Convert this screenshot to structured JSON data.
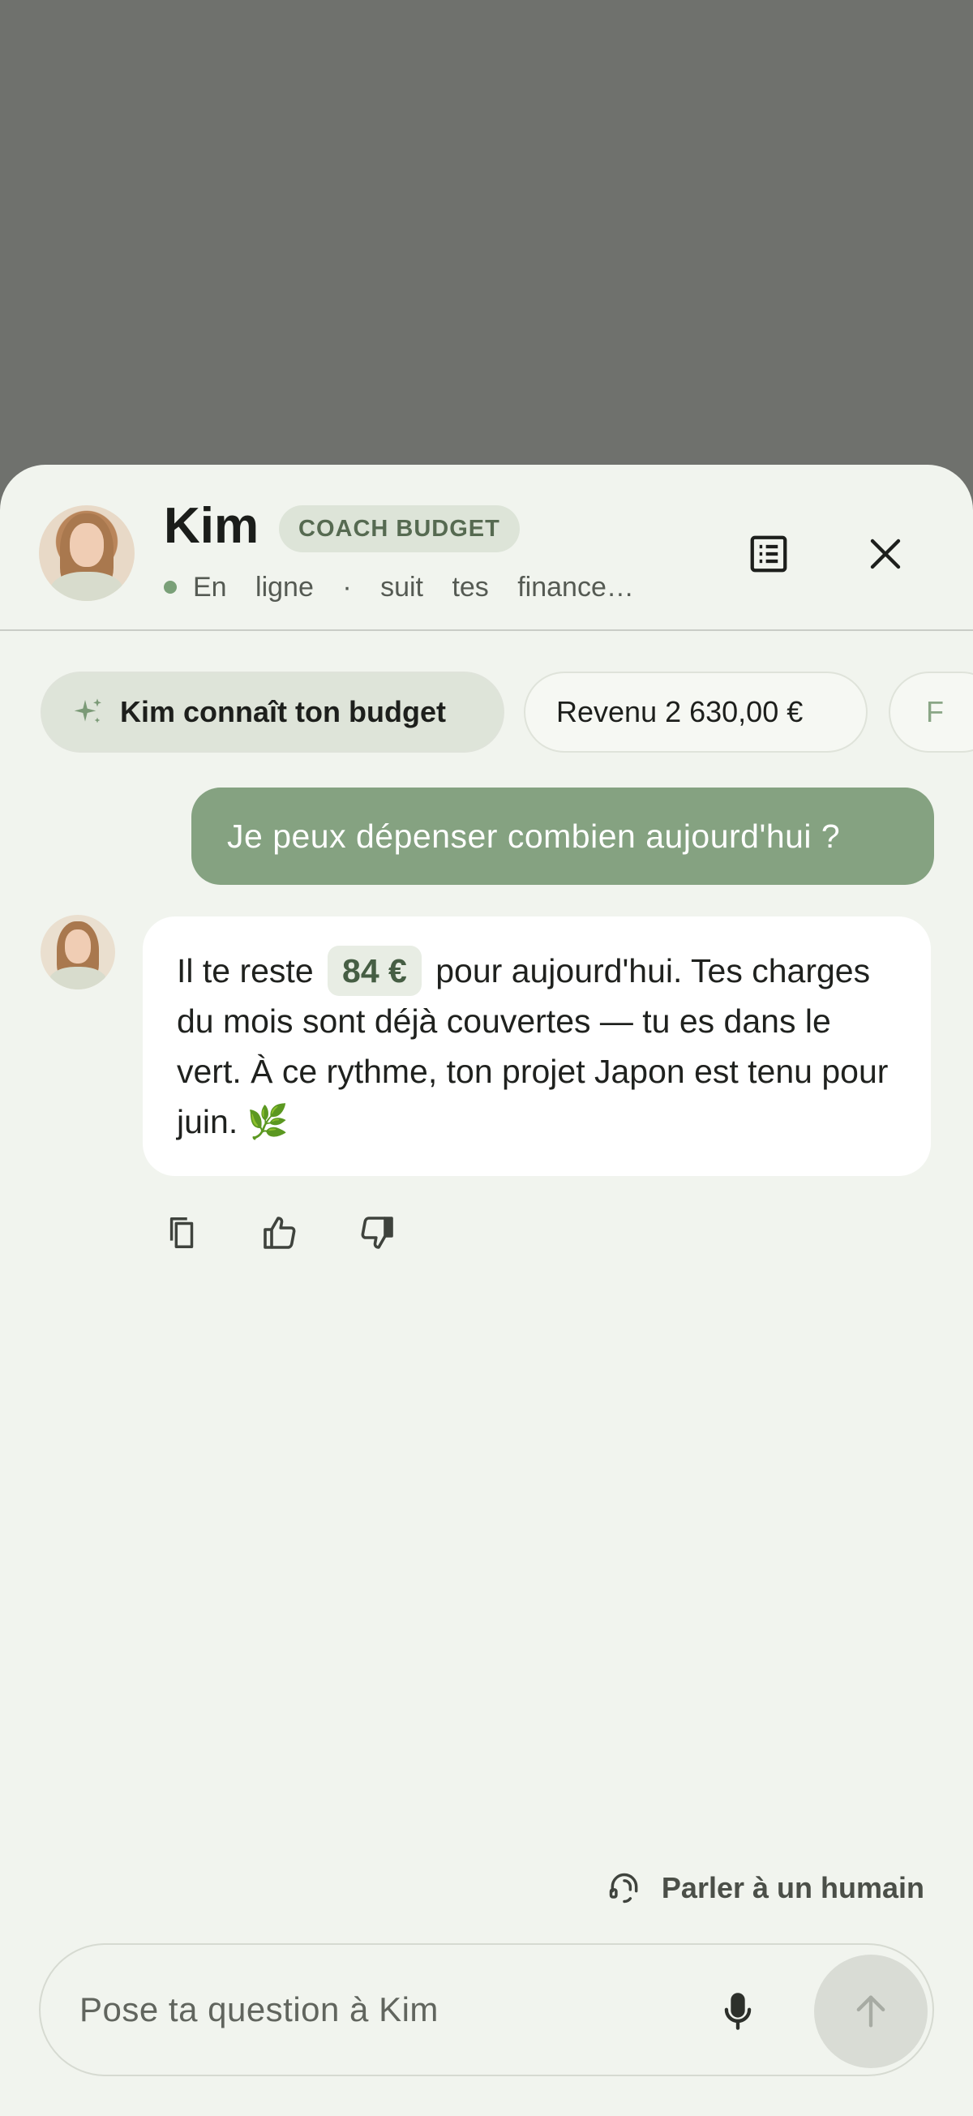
{
  "header": {
    "name": "Kim",
    "badge": "COACH BUDGET",
    "status": "En ligne · suit tes finance…",
    "avatar_icon": "avatar-kim",
    "menu_icon": "list-icon",
    "close_icon": "close-icon"
  },
  "chips": [
    {
      "label": "Kim connaît ton budget",
      "icon": "sparkle-icon"
    },
    {
      "label": "Revenu 2 630,00 €"
    },
    {
      "label": "F"
    }
  ],
  "conversation": {
    "user_message": "Je peux dépenser combien aujourd'hui ?",
    "bot_message": {
      "before": "Il te reste",
      "amount": "84 €",
      "after": "pour aujourd'hui. Tes charges du mois sont déjà couvertes — tu es dans le vert. À ce rythme, ton projet Japon est tenu pour juin. 🌿"
    },
    "actions": [
      "copy-icon",
      "thumbs-up-icon",
      "thumbs-down-icon"
    ]
  },
  "human_link": {
    "label": "Parler à un humain",
    "icon": "headset-icon"
  },
  "composer": {
    "placeholder": "Pose ta question à Kim",
    "mic_icon": "mic-icon",
    "send_icon": "send-arrow-icon"
  },
  "colors": {
    "accent": "#85a281",
    "background": "#f1f4ee",
    "overlay": "#6f716d"
  }
}
